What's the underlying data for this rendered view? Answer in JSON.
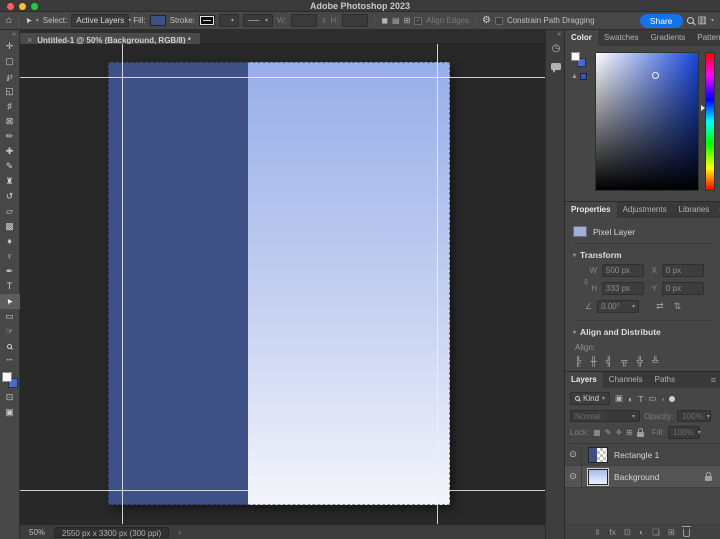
{
  "window": {
    "title": "Adobe Photoshop 2023"
  },
  "icons": {
    "home": "⌂",
    "cursor": "➤",
    "caret": "▾",
    "check": "✓",
    "path_ops": "◼",
    "path_align": "▤",
    "path_arrange": "⊞",
    "gear": "⚙",
    "workspace": "▥",
    "menu": "≡",
    "collapse": "»",
    "expand": "«",
    "history": "◷",
    "eye": "⊙",
    "link": "∞",
    "angle": "∠",
    "flip_h": "⇄",
    "flip_v": "⇅",
    "more": "•••",
    "align_left": "╠",
    "align_center": "╫",
    "align_right": "╣",
    "align_top": "╦",
    "align_middle": "╬",
    "align_bottom": "╩",
    "fx": "fx",
    "mask": "⊡",
    "adjustment": "◐",
    "folder": "❏",
    "new_layer": "⊞",
    "filter_image": "▣",
    "filter_adjustment": "◐",
    "filter_type": "T",
    "filter_shape": "▭",
    "filter_smart": "▫",
    "lock_transparent": "▦",
    "lock_paint": "✎",
    "lock_move": "✛",
    "lock_artboard": "⊞",
    "warning": "▲",
    "chevron": "›",
    "quick_mask": "⊡",
    "screen_mode": "▣"
  },
  "options": {
    "select_label": "Select:",
    "select_value": "Active Layers",
    "fill_label": "Fill:",
    "stroke_label": "Stroke:",
    "w_label": "W:",
    "h_label": "H:",
    "align_edges_label": "Align Edges",
    "constrain_label": "Constrain Path Dragging",
    "share_label": "Share"
  },
  "tools": [
    {
      "name": "move-tool",
      "glyph": "✛"
    },
    {
      "name": "marquee-tool",
      "glyph": "▢"
    },
    {
      "name": "lasso-tool",
      "glyph": "℘"
    },
    {
      "name": "object-selection-tool",
      "glyph": "◱"
    },
    {
      "name": "crop-tool",
      "glyph": "♯"
    },
    {
      "name": "frame-tool",
      "glyph": "⊠"
    },
    {
      "name": "eyedropper-tool",
      "glyph": "✏"
    },
    {
      "name": "healing-brush-tool",
      "glyph": "✚"
    },
    {
      "name": "brush-tool",
      "glyph": "✎"
    },
    {
      "name": "clone-stamp-tool",
      "glyph": "♜"
    },
    {
      "name": "history-brush-tool",
      "glyph": "↺"
    },
    {
      "name": "eraser-tool",
      "glyph": "▱"
    },
    {
      "name": "gradient-tool",
      "glyph": "▩"
    },
    {
      "name": "blur-tool",
      "glyph": "♦"
    },
    {
      "name": "dodge-tool",
      "glyph": "♀"
    },
    {
      "name": "pen-tool",
      "glyph": "✒"
    },
    {
      "name": "type-tool",
      "glyph": "T"
    },
    {
      "name": "path-selection-tool",
      "glyph": "➤",
      "selected": true
    },
    {
      "name": "rectangle-tool",
      "glyph": "▭"
    },
    {
      "name": "hand-tool",
      "glyph": "☞"
    },
    {
      "name": "zoom-tool",
      "glyph": ""
    },
    {
      "name": "edit-toolbar",
      "glyph": "•••"
    }
  ],
  "tab": {
    "close": "×",
    "title": "Untitled-1 @ 50% (Background, RGB/8) *"
  },
  "panels": {
    "color": {
      "tabs": [
        "Color",
        "Swatches",
        "Gradients",
        "Patterns"
      ]
    },
    "properties": {
      "tabs": [
        "Properties",
        "Adjustments",
        "Libraries"
      ],
      "layer_type": "Pixel Layer",
      "transform_label": "Transform",
      "w_label": "W",
      "w_value": "500 px",
      "x_label": "X",
      "x_value": "0 px",
      "h_label": "H",
      "h_value": "333 px",
      "y_label": "Y",
      "y_value": "0 px",
      "angle_value": "0.00°",
      "align_header": "Align and Distribute",
      "align_label": "Align:"
    },
    "layers": {
      "tabs": [
        "Layers",
        "Channels",
        "Paths"
      ],
      "kind_label": "Kind",
      "blend_mode": "Normal",
      "opacity_label": "Opacity:",
      "opacity_value": "100%",
      "lock_label": "Lock:",
      "fill_label": "Fill:",
      "fill_value": "100%",
      "rows": [
        {
          "name": "Rectangle 1",
          "visible": true,
          "selected": false
        },
        {
          "name": "Background",
          "visible": true,
          "selected": true,
          "locked": true
        }
      ]
    }
  },
  "status": {
    "zoom": "50%",
    "doc_size": "2550 px x 3300 px (300 ppi)"
  },
  "colors": {
    "accent_blue": "#1473e6",
    "fill_blue": "#3e5288",
    "rect_blue": "#3e5085",
    "bg_swatch_blue": "#4b68d9",
    "gradient_top": "#98aee9",
    "gradient_bottom": "#f3f5fb"
  }
}
